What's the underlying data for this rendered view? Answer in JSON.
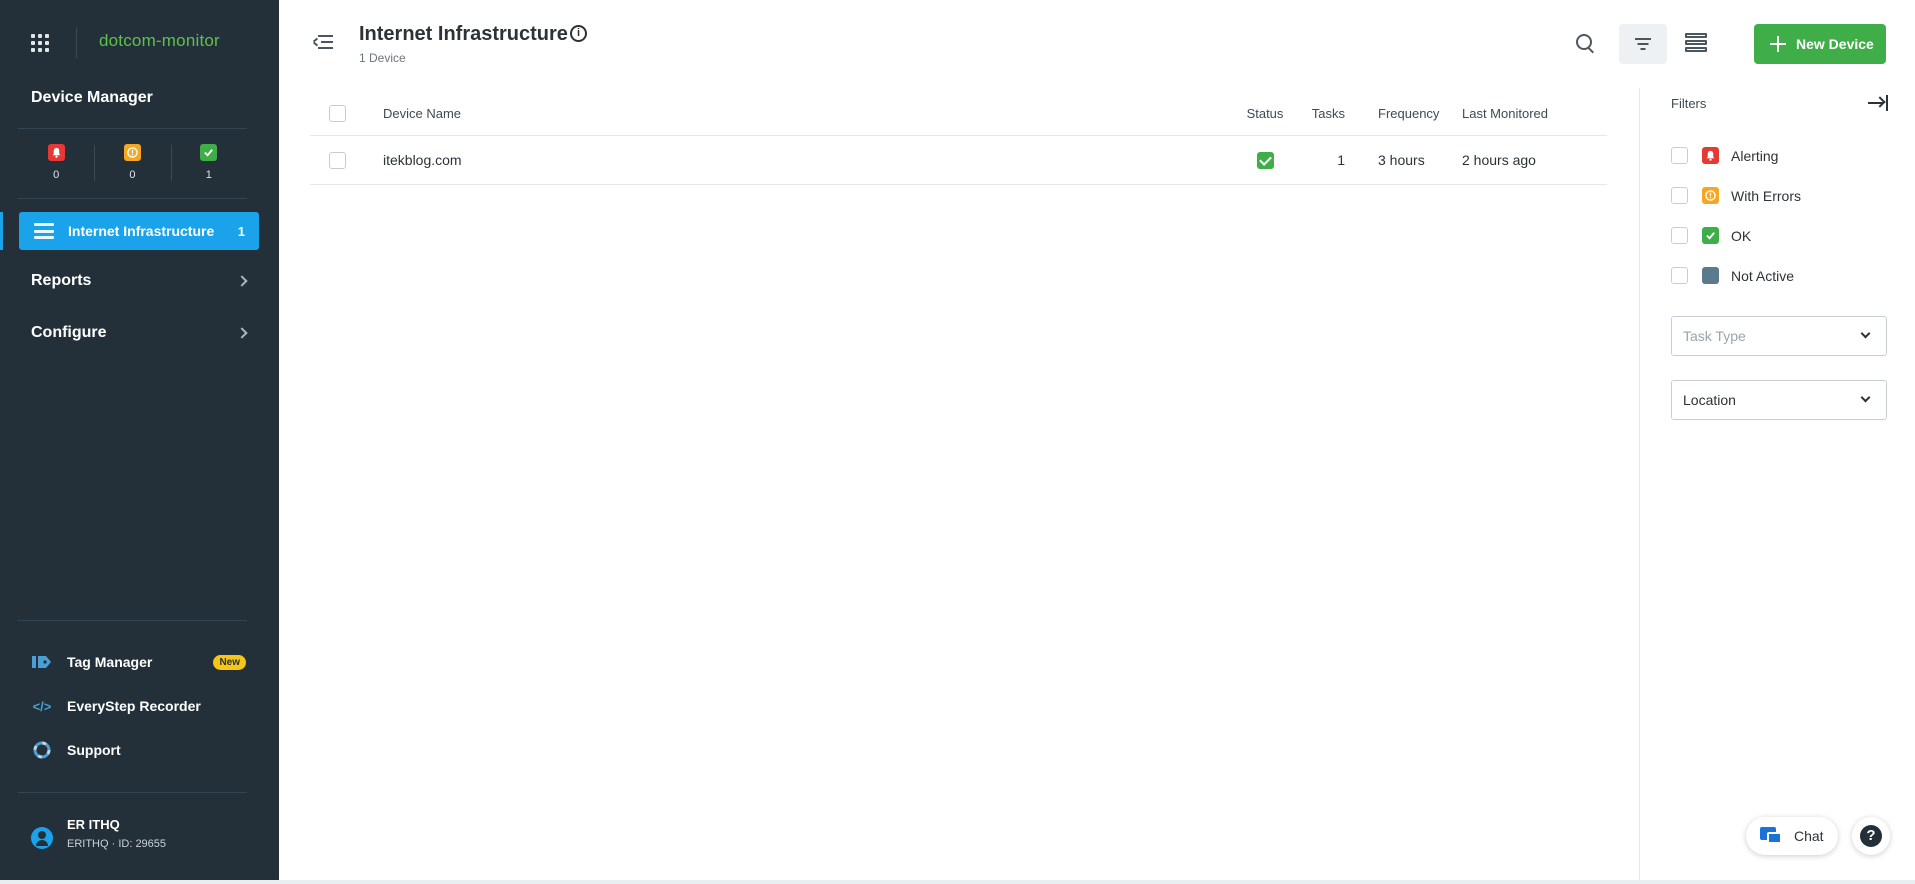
{
  "app": {
    "logo_text": "dotcom-monitor",
    "logo_color": "#5cc24a",
    "section_title": "Device Manager"
  },
  "status_summary": [
    {
      "name": "alerting",
      "icon": "bell-icon",
      "color": "#e53935",
      "count": "0"
    },
    {
      "name": "errors",
      "icon": "exclamation-icon",
      "color": "#f5a623",
      "count": "0"
    },
    {
      "name": "ok",
      "icon": "check-icon",
      "color": "#3fae49",
      "count": "1"
    }
  ],
  "nav": {
    "active": {
      "label": "Internet Infrastructure",
      "count": "1",
      "icon": "infrastructure-icon",
      "color": "#1aa3ea"
    },
    "items": [
      {
        "label": "Reports",
        "icon": "chevron-right-icon"
      },
      {
        "label": "Configure",
        "icon": "chevron-right-icon"
      }
    ]
  },
  "tools": [
    {
      "label": "Tag Manager",
      "icon": "tag-icon",
      "badge": "New"
    },
    {
      "label": "EveryStep Recorder",
      "icon": "code-icon"
    },
    {
      "label": "Support",
      "icon": "lifebuoy-icon"
    }
  ],
  "user": {
    "name": "ER ITHQ",
    "id_line": "ERITHQ · ID: 29655"
  },
  "header": {
    "title": "Internet Infrastructure",
    "subtitle": "1 Device",
    "new_device_label": "New Device",
    "accent": "#3fae49"
  },
  "table": {
    "columns": [
      "Device Name",
      "Status",
      "Tasks",
      "Frequency",
      "Last Monitored"
    ],
    "rows": [
      {
        "name": "itekblog.com",
        "status": "ok",
        "tasks": "1",
        "frequency": "3 hours",
        "last_monitored": "2 hours ago"
      }
    ]
  },
  "filters": {
    "title": "Filters",
    "options": [
      {
        "label": "Alerting",
        "color": "#e53935",
        "icon": "bell-icon"
      },
      {
        "label": "With Errors",
        "color": "#f5a623",
        "icon": "exclamation-icon"
      },
      {
        "label": "OK",
        "color": "#3fae49",
        "icon": "check-icon"
      },
      {
        "label": "Not Active",
        "color": "#5c7a8e",
        "icon": "square-icon"
      }
    ],
    "task_type_placeholder": "Task Type",
    "location_label": "Location"
  },
  "chat": {
    "label": "Chat"
  },
  "help": {
    "label": "?"
  }
}
